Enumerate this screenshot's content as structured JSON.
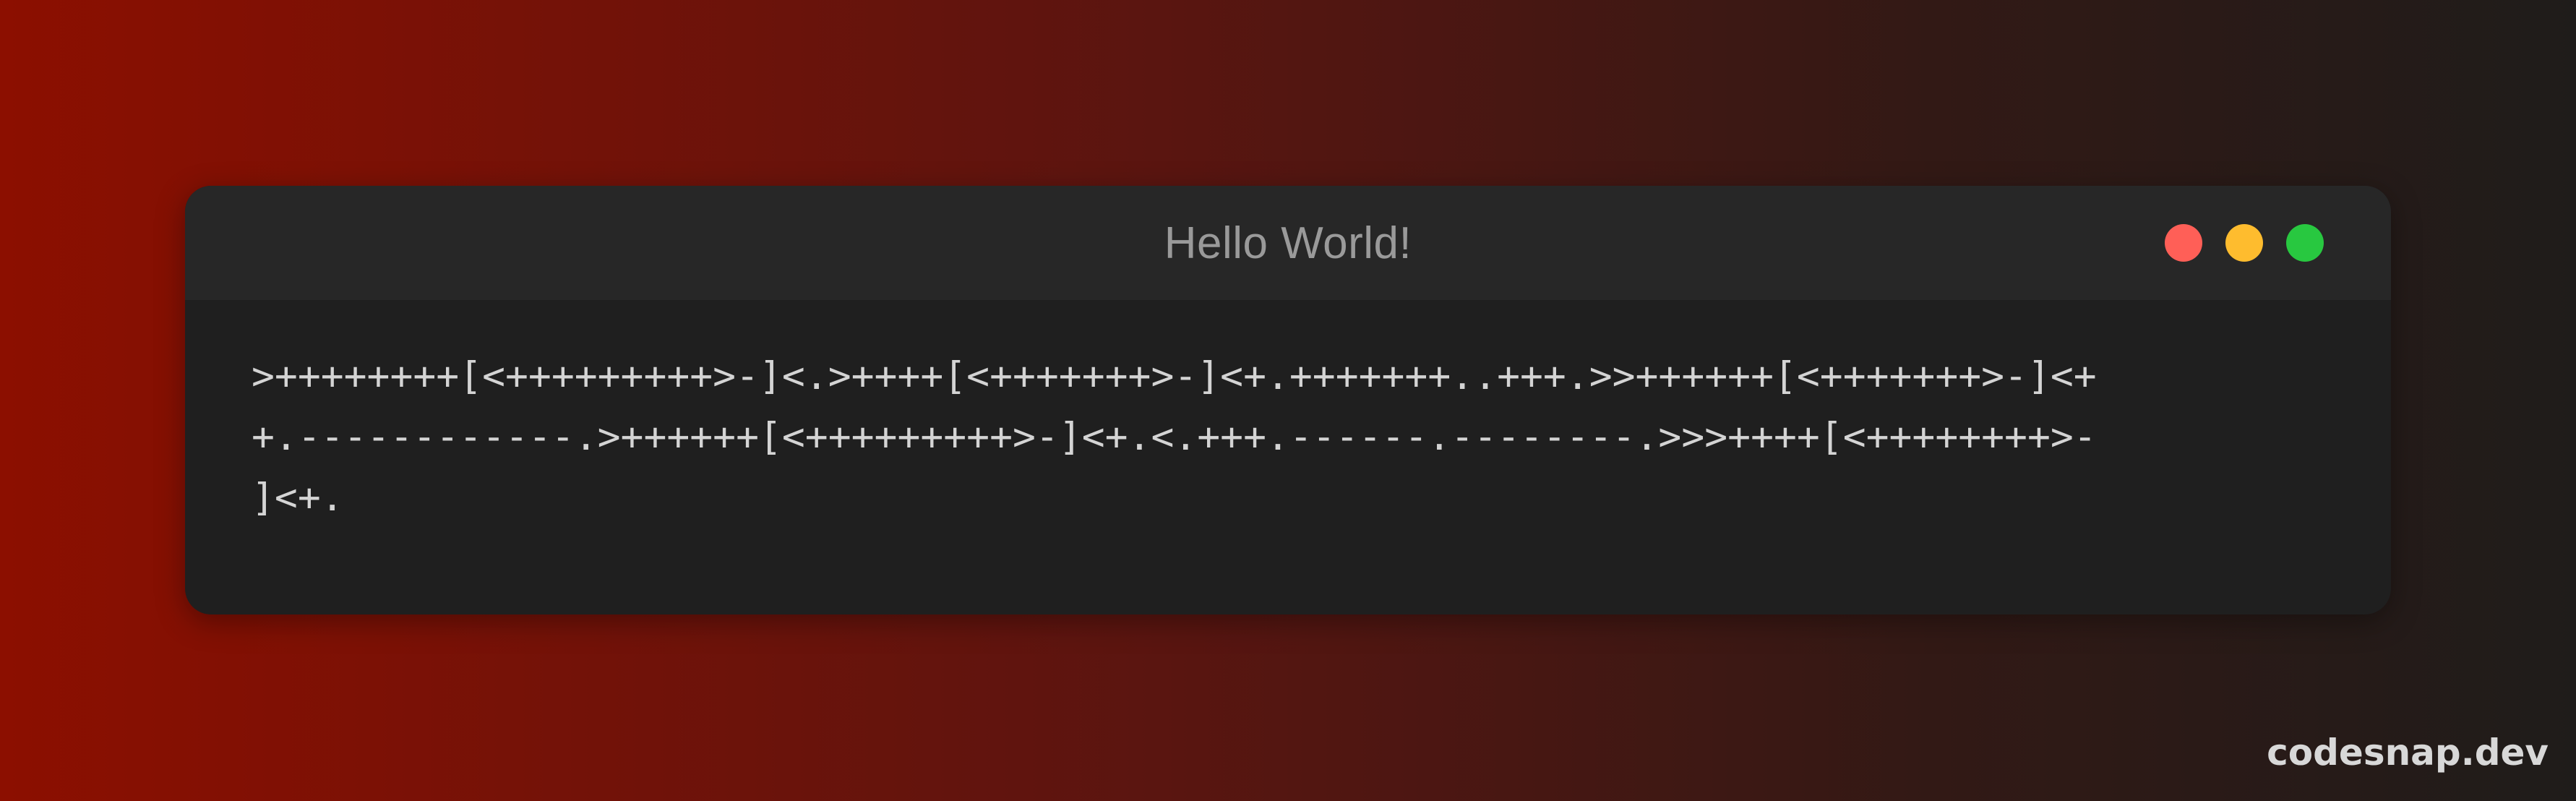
{
  "window": {
    "title": "Hello World!",
    "controls": [
      {
        "name": "close",
        "color": "#ff5f57"
      },
      {
        "name": "minimize",
        "color": "#febc2e"
      },
      {
        "name": "maximize",
        "color": "#28c840"
      }
    ]
  },
  "code": {
    "lines": [
      ">++++++++[<+++++++++>-]<.>++++[<+++++++>-]<+.+++++++..+++.>>++++++[<+++++++>-]<+",
      "+.------------.>++++++[<+++++++++>-]<+.<.+++.------.--------.>>>++++[<++++++++>-",
      "]<+."
    ]
  },
  "brand": {
    "label": "codesnap.dev"
  },
  "colors": {
    "background_start": "#8c0f00",
    "background_end": "#1f1c1a",
    "window_bg": "#1f1f1f",
    "titlebar_bg": "#272727"
  }
}
